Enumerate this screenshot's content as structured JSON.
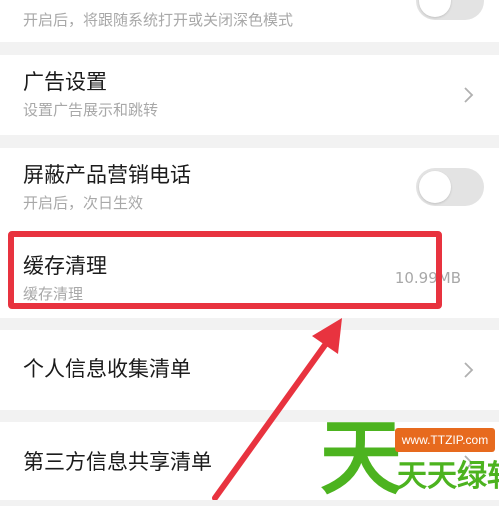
{
  "items": [
    {
      "title": "开启后，将跟随系统打开或关闭深色模式",
      "type": "toggle",
      "state": "off"
    },
    {
      "title": "广告设置",
      "subtitle": "设置广告展示和跳转",
      "type": "link"
    },
    {
      "title": "屏蔽产品营销电话",
      "subtitle": "开启后，次日生效",
      "type": "toggle",
      "state": "off"
    },
    {
      "title": "缓存清理",
      "subtitle": "缓存清理",
      "value": "10.99MB",
      "type": "value",
      "highlighted": true
    },
    {
      "title": "个人信息收集清单",
      "type": "link"
    },
    {
      "title": "第三方信息共享清单",
      "type": "link"
    }
  ],
  "watermark": {
    "big_char": "天",
    "url": "www.TTZIP.com",
    "name": "天天绿软"
  },
  "colors": {
    "highlight": "#e8333f",
    "arrow": "#e8333f",
    "watermark_green": "#4cb31f",
    "watermark_orange": "#e76a1e"
  }
}
